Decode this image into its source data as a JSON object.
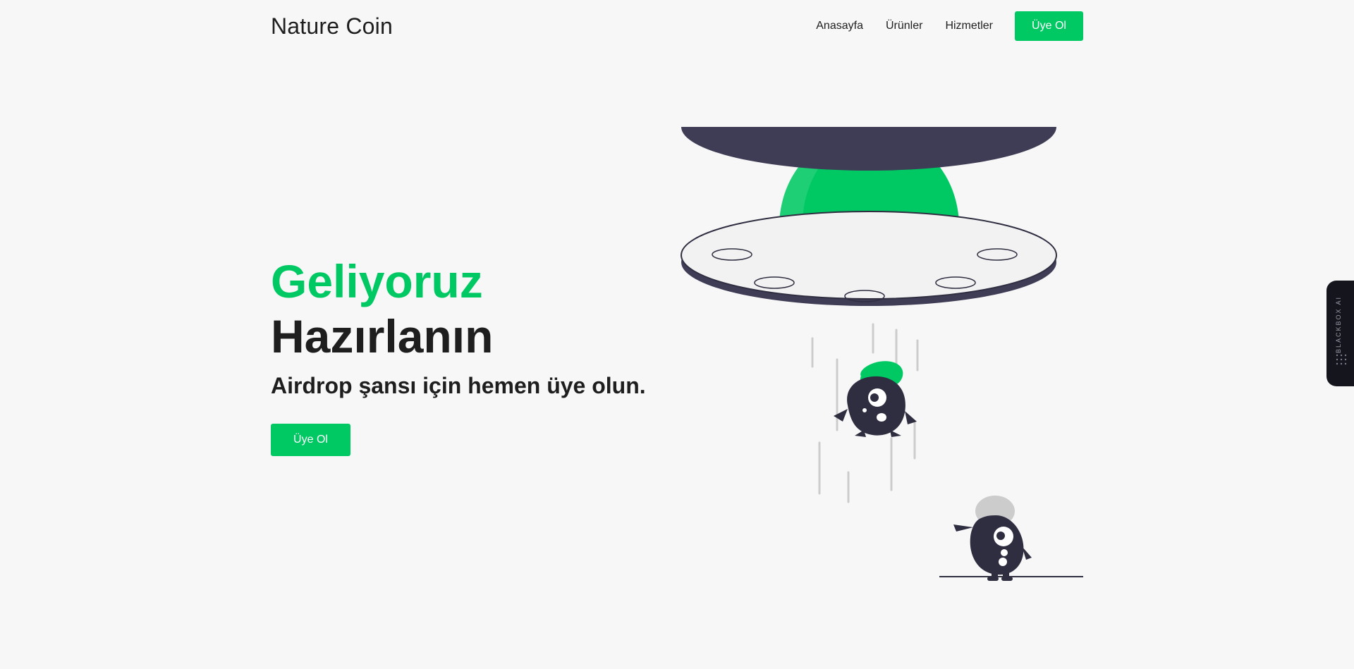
{
  "header": {
    "brand": "Nature Coin",
    "nav": [
      {
        "label": "Anasayfa"
      },
      {
        "label": "Ürünler"
      },
      {
        "label": "Hizmetler"
      }
    ],
    "signup_label": "Üye Ol"
  },
  "hero": {
    "title_green": "Geliyoruz",
    "title_dark": "Hazırlanın",
    "subtitle": "Airdrop şansı için hemen üye olun.",
    "cta_label": "Üye Ol"
  },
  "side_widget": {
    "label": "BLACKBOX AI",
    "icon": "dot-grid-icon"
  },
  "colors": {
    "accent": "#00c964",
    "text": "#1e1e1e",
    "background": "#f7f7f7",
    "dark_navy": "#2f2e41",
    "widget_bg": "#15151e"
  }
}
